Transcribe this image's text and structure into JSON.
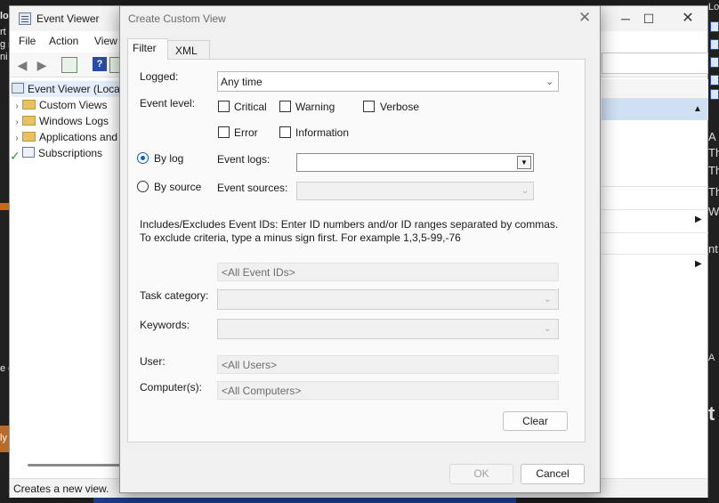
{
  "background": {
    "left_texts": [
      "lo",
      "rt",
      "g s",
      "ni",
      "e c",
      "ly"
    ],
    "right_texts": [
      "Lo",
      "A",
      "Th",
      "Th",
      "Th",
      "W",
      "nt",
      "A",
      "t"
    ]
  },
  "event_viewer": {
    "title": "Event Viewer",
    "menu": [
      "File",
      "Action",
      "View"
    ],
    "tree": {
      "root": "Event Viewer (Local)",
      "items": [
        "Custom Views",
        "Windows Logs",
        "Applications and Services Logs",
        "Subscriptions"
      ]
    },
    "status": "Creates a new view."
  },
  "dialog": {
    "title": "Create Custom View",
    "tabs": [
      "Filter",
      "XML"
    ],
    "logged_label": "Logged:",
    "logged_value": "Any time",
    "event_level_label": "Event level:",
    "levels": [
      "Critical",
      "Warning",
      "Verbose",
      "Error",
      "Information"
    ],
    "by_log_label": "By log",
    "by_source_label": "By source",
    "event_logs_label": "Event logs:",
    "event_sources_label": "Event sources:",
    "includes_text": "Includes/Excludes Event IDs: Enter ID numbers and/or ID ranges separated by commas. To exclude criteria, type a minus sign first. For example 1,3,5-99,-76",
    "event_ids_placeholder": "<All Event IDs>",
    "task_category_label": "Task category:",
    "keywords_label": "Keywords:",
    "user_label": "User:",
    "user_placeholder": "<All Users>",
    "computer_label": "Computer(s):",
    "computer_placeholder": "<All Computers>",
    "clear_button": "Clear",
    "ok_button": "OK",
    "cancel_button": "Cancel"
  }
}
